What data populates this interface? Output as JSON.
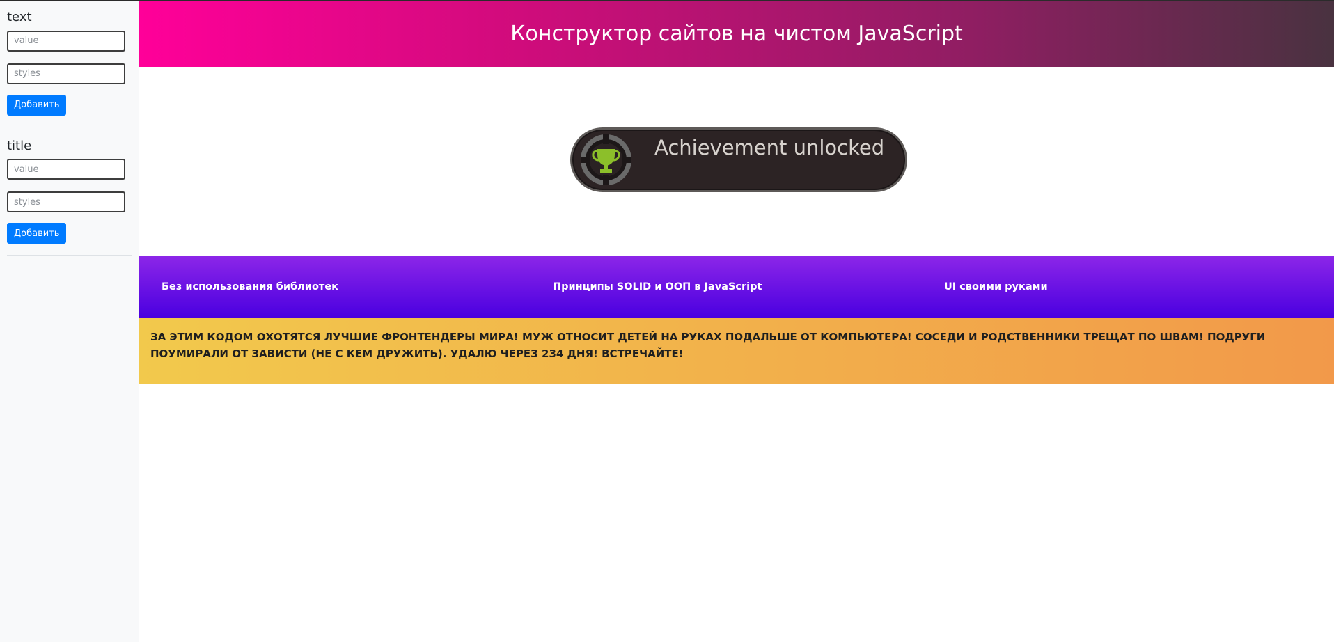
{
  "sidebar": {
    "panels": [
      {
        "title": "text",
        "value_placeholder": "value",
        "styles_placeholder": "styles",
        "button_label": "Добавить"
      },
      {
        "title": "title",
        "value_placeholder": "value",
        "styles_placeholder": "styles",
        "button_label": "Добавить"
      }
    ]
  },
  "header": {
    "title": "Конструктор сайтов на чистом JavaScript",
    "gradient": [
      "#ff0099",
      "#493240"
    ]
  },
  "hero": {
    "image_text": "Achievement unlocked",
    "image_icon": "trophy-icon"
  },
  "features": {
    "items": [
      "Без использования библиотек",
      "Принципы SOLID и ООП в JavaScript",
      "UI своими руками"
    ],
    "gradient": [
      "#8e2de2",
      "#4a00e0"
    ]
  },
  "banner": {
    "text": "ЗА ЭТИМ КОДОМ ОХОТЯТСЯ ЛУЧШИЕ ФРОНТЕНДЕРЫ МИРА! МУЖ ОТНОСИТ ДЕТЕЙ НА РУКАХ ПОДАЛЬШЕ ОТ КОМПЬЮТЕРА! СОСЕДИ И РОДСТВЕННИКИ ТРЕЩАТ ПО ШВАМ! ПОДРУГИ ПОУМИРАЛИ ОТ ЗАВИСТИ (НЕ С КЕМ ДРУЖИТЬ). УДАЛЮ ЧЕРЕЗ 234 ДНЯ! ВСТРЕЧАЙТЕ!",
    "gradient": [
      "#f2c94c",
      "#f2994a"
    ]
  },
  "colors": {
    "button": "#007bff",
    "sidebar_bg": "#f8f9fa"
  }
}
